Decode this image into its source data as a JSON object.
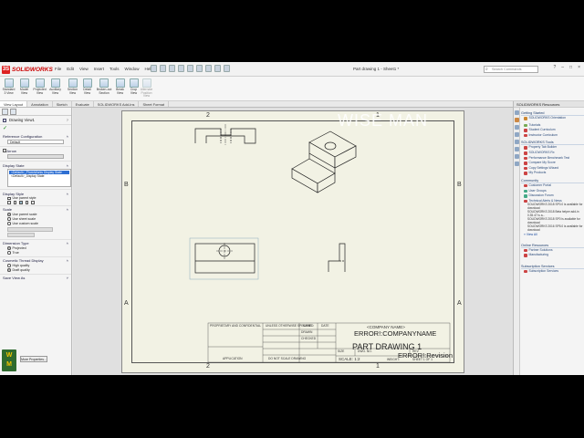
{
  "app": {
    "logo_text": "SOLIDWORKS",
    "menu": [
      "File",
      "Edit",
      "View",
      "Insert",
      "Tools",
      "Window",
      "Help"
    ],
    "document_title": "Part drawing 1 - Sheet1 *",
    "search_placeholder": "Search Commands",
    "window_controls": [
      "?",
      "–",
      "□",
      "×"
    ]
  },
  "ribbon": [
    {
      "label": "Standard 3 View",
      "icon": "standard-3-view-icon",
      "enabled": true
    },
    {
      "label": "Model View",
      "icon": "model-view-icon",
      "enabled": true
    },
    {
      "label": "Projected View",
      "icon": "projected-view-icon",
      "enabled": true
    },
    {
      "label": "Auxiliary View",
      "icon": "auxiliary-view-icon",
      "enabled": true
    },
    {
      "label": "Section View",
      "icon": "section-view-icon",
      "enabled": true
    },
    {
      "label": "Detail View",
      "icon": "detail-view-icon",
      "enabled": true
    },
    {
      "label": "Broken-out Section",
      "icon": "broken-out-section-icon",
      "enabled": true
    },
    {
      "label": "Break View",
      "icon": "break-view-icon",
      "enabled": true
    },
    {
      "label": "Crop View",
      "icon": "crop-view-icon",
      "enabled": true
    },
    {
      "label": "Alternate Position View",
      "icon": "alternate-position-view-icon",
      "enabled": false
    }
  ],
  "tabs": [
    "View Layout",
    "Annotation",
    "Sketch",
    "Evaluate",
    "SOLIDWORKS Add-Ins",
    "Sheet Format"
  ],
  "active_tab": "View Layout",
  "property_manager": {
    "title": "Drawing View1",
    "help": "?",
    "ok_symbol": "✓",
    "reference_configuration": {
      "header": "Reference Configuration",
      "value": "Default"
    },
    "arrow": {
      "header": "Arrow"
    },
    "display_state": {
      "header": "Display State",
      "items": [
        "<Default>_PhotoWorks Display State",
        "<Default>_Display State"
      ],
      "selected_index": 0
    },
    "display_style": {
      "header": "Display Style",
      "use_parent_style": "Use parent style"
    },
    "scale": {
      "header": "Scale",
      "options": [
        "Use parent scale",
        "Use sheet scale",
        "Use custom scale"
      ],
      "selected_index": 0
    },
    "dimension_type": {
      "header": "Dimension Type",
      "options": [
        "Projected",
        "True"
      ],
      "selected_index": 0
    },
    "cosmetic_thread": {
      "header": "Cosmetic Thread Display",
      "options": [
        "High quality",
        "Draft quality"
      ],
      "selected_index": 1
    },
    "save_view_as": {
      "header": "Save View As"
    },
    "more_properties": "More Properties..."
  },
  "drawing": {
    "watermark": "WISE MAN",
    "zones_top": [
      "2",
      "1"
    ],
    "zones_side": [
      "B",
      "A"
    ],
    "title_block": {
      "company": "<COMPANY NAME>",
      "error_company": "ERROR!:COMPANYNAME",
      "part_name": "PART DRAWING 1",
      "error_revision": "ERROR!:Revision",
      "size": "SIZE",
      "dwg_no": "DWG. NO.",
      "rev": "REV",
      "scale": "SCALE: 1:2",
      "weight": "WEIGHT:",
      "sheet": "SHEET 1 OF 1",
      "notes": "UNLESS OTHERWISE SPECIFIED:",
      "proprietary": "PROPRIETARY AND CONFIDENTIAL",
      "name": "NAME",
      "date": "DATE",
      "drawn": "DRAWN",
      "checked": "CHECKED",
      "application": "APPLICATION",
      "do_not_scale": "DO NOT SCALE DRAWING"
    }
  },
  "task_pane": {
    "header": "SOLIDWORKS Resources",
    "sections": [
      {
        "title": "Getting Started",
        "items": [
          {
            "label": "SOLIDWORKS Orientation",
            "color": "#c83"
          }
        ]
      },
      {
        "title": "SOLIDWORKS Orientation",
        "items": [
          {
            "label": "Tutorials",
            "color": "#7a5"
          },
          {
            "label": "Student Curriculum",
            "color": "#c44"
          },
          {
            "label": "Instructor Curriculum",
            "color": "#c44"
          }
        ]
      },
      {
        "title": "SOLIDWORKS Tools",
        "items": [
          {
            "label": "Property Tab Builder",
            "color": "#c44"
          },
          {
            "label": "SOLIDWORKS Rx",
            "color": "#c44"
          },
          {
            "label": "Performance Benchmark Test",
            "color": "#c44"
          },
          {
            "label": "Compare My Score",
            "color": "#c44"
          },
          {
            "label": "Copy Settings Wizard",
            "color": "#c44"
          },
          {
            "label": "My Products",
            "color": "#c44"
          }
        ]
      },
      {
        "title": "Community",
        "items": [
          {
            "label": "Customer Portal",
            "color": "#c44"
          },
          {
            "label": "User Groups",
            "color": "#4a8"
          },
          {
            "label": "Discussion Forum",
            "color": "#4a8"
          },
          {
            "label": "Technical Alerts & News",
            "color": "#c44"
          }
        ]
      }
    ],
    "news": [
      "SOLIDWORKS 2018 SP0.0 is available for download",
      "SOLIDWORKS 2018 Beta helper add-in 0.35.47 is a...",
      "SOLIDWORKS 2018 SP0 is available for download",
      "SOLIDWORKS 2016 SP5.0 is available for download"
    ],
    "view_all": "» View All",
    "sections_after": [
      {
        "title": "Online Resources",
        "items": [
          {
            "label": "Partner Solutions",
            "color": "#c44"
          },
          {
            "label": "Manufacturing",
            "color": "#c44"
          }
        ]
      },
      {
        "title": "Subscription Services",
        "items": [
          {
            "label": "Subscription Services",
            "color": "#c44"
          }
        ]
      }
    ]
  }
}
